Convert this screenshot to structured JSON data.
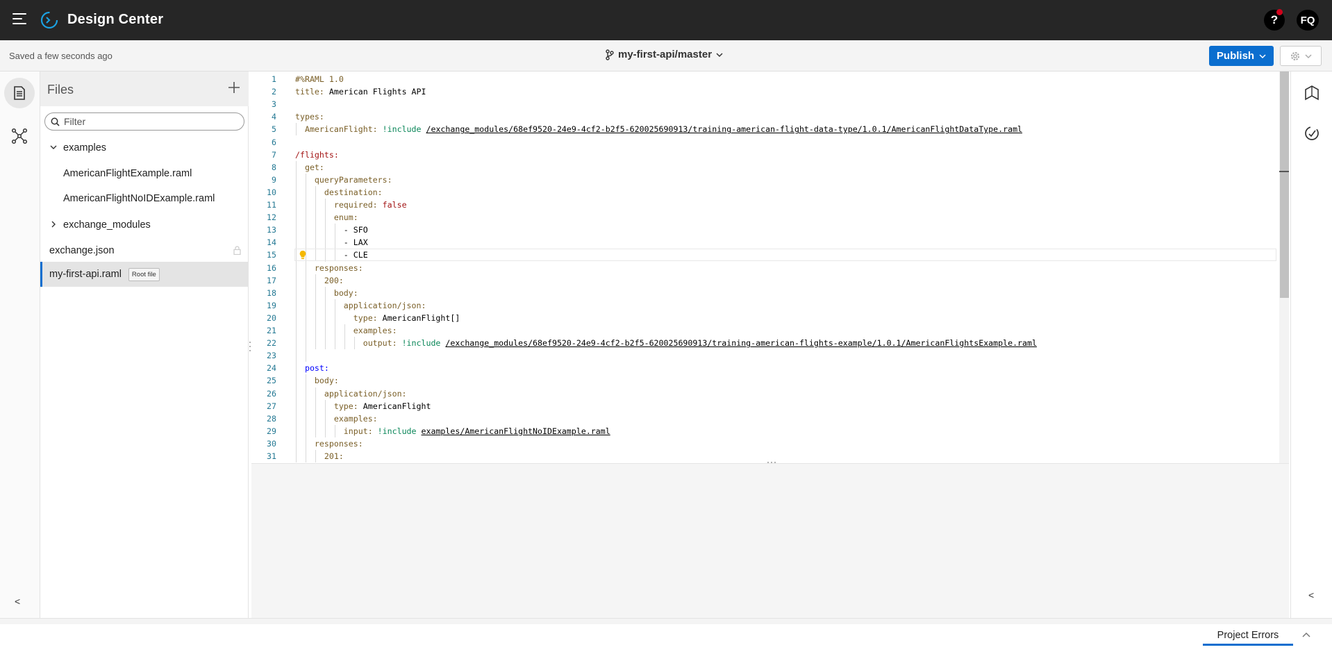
{
  "topbar": {
    "title": "Design Center",
    "help_label": "?",
    "avatar_initials": "FQ"
  },
  "subheader": {
    "saved_status": "Saved a few seconds ago",
    "branch": "my-first-api/master",
    "publish_label": "Publish"
  },
  "files": {
    "title": "Files",
    "filter_placeholder": "Filter",
    "folder_examples": "examples",
    "file_example1": "AmericanFlightExample.raml",
    "file_example2": "AmericanFlightNoIDExample.raml",
    "folder_exchange": "exchange_modules",
    "file_exchange_json": "exchange.json",
    "file_root": "my-first-api.raml",
    "root_badge": "Root file"
  },
  "editor": {
    "line_numbers": [
      "1",
      "2",
      "3",
      "4",
      "5",
      "6",
      "7",
      "8",
      "9",
      "10",
      "11",
      "12",
      "13",
      "14",
      "15",
      "16",
      "17",
      "18",
      "19",
      "20",
      "21",
      "22",
      "23",
      "24",
      "25",
      "26",
      "27",
      "28",
      "29",
      "30",
      "31"
    ],
    "lines": [
      [
        {
          "t": "#%RAML 1.0",
          "c": "k"
        }
      ],
      [
        {
          "t": "title:",
          "c": "k"
        },
        {
          "t": " American Flights API",
          "c": "plain"
        }
      ],
      [],
      [
        {
          "t": "types:",
          "c": "k"
        }
      ],
      [
        {
          "t": "  AmericanFlight:",
          "c": "k"
        },
        {
          "t": " !include ",
          "c": "inc"
        },
        {
          "t": "/exchange_modules/68ef9520-24e9-4cf2-b2f5-620025690913/training-american-flight-data-type/1.0.1/AmericanFlightDataType.raml",
          "c": "u"
        }
      ],
      [],
      [
        {
          "t": "/flights:",
          "c": "s"
        }
      ],
      [
        {
          "t": "  get:",
          "c": "k"
        }
      ],
      [
        {
          "t": "    queryParameters:",
          "c": "k"
        }
      ],
      [
        {
          "t": "      destination:",
          "c": "k"
        }
      ],
      [
        {
          "t": "        required:",
          "c": "k"
        },
        {
          "t": " false",
          "c": "s"
        }
      ],
      [
        {
          "t": "        enum:",
          "c": "k"
        }
      ],
      [
        {
          "t": "          - SFO",
          "c": "plain"
        }
      ],
      [
        {
          "t": "          - LAX",
          "c": "plain"
        }
      ],
      [
        {
          "t": "          - CLE",
          "c": "plain"
        }
      ],
      [
        {
          "t": "    responses:",
          "c": "k"
        }
      ],
      [
        {
          "t": "      200:",
          "c": "k"
        }
      ],
      [
        {
          "t": "        body:",
          "c": "k"
        }
      ],
      [
        {
          "t": "          application/json:",
          "c": "k"
        }
      ],
      [
        {
          "t": "            type:",
          "c": "k"
        },
        {
          "t": " AmericanFlight[]",
          "c": "plain"
        }
      ],
      [
        {
          "t": "            examples:",
          "c": "k"
        }
      ],
      [
        {
          "t": "              output:",
          "c": "k"
        },
        {
          "t": " !include ",
          "c": "inc"
        },
        {
          "t": "/exchange_modules/68ef9520-24e9-4cf2-b2f5-620025690913/training-american-flights-example/1.0.1/AmericanFlightsExample.raml",
          "c": "u"
        }
      ],
      [],
      [
        {
          "t": "  post:",
          "c": "b"
        }
      ],
      [
        {
          "t": "    body:",
          "c": "k"
        }
      ],
      [
        {
          "t": "      application/json:",
          "c": "k"
        }
      ],
      [
        {
          "t": "        type:",
          "c": "k"
        },
        {
          "t": " AmericanFlight",
          "c": "plain"
        }
      ],
      [
        {
          "t": "        examples:",
          "c": "k"
        }
      ],
      [
        {
          "t": "          input:",
          "c": "k"
        },
        {
          "t": " !include ",
          "c": "inc"
        },
        {
          "t": "examples/AmericanFlightNoIDExample.raml",
          "c": "u"
        }
      ],
      [
        {
          "t": "    responses:",
          "c": "k"
        }
      ],
      [
        {
          "t": "      201:",
          "c": "k"
        }
      ]
    ]
  },
  "footer": {
    "errors_label": "Project Errors"
  },
  "icons": {
    "menu": "hamburger-icon",
    "logo": "design-center-logo",
    "branch": "git-branch-icon",
    "files": "files-icon",
    "graph": "api-graph-icon",
    "doc": "documentation-icon",
    "mock": "mocking-service-icon"
  },
  "colors": {
    "topbar": "#262626",
    "accent": "#0b6ecf",
    "notification": "#d0021b"
  }
}
